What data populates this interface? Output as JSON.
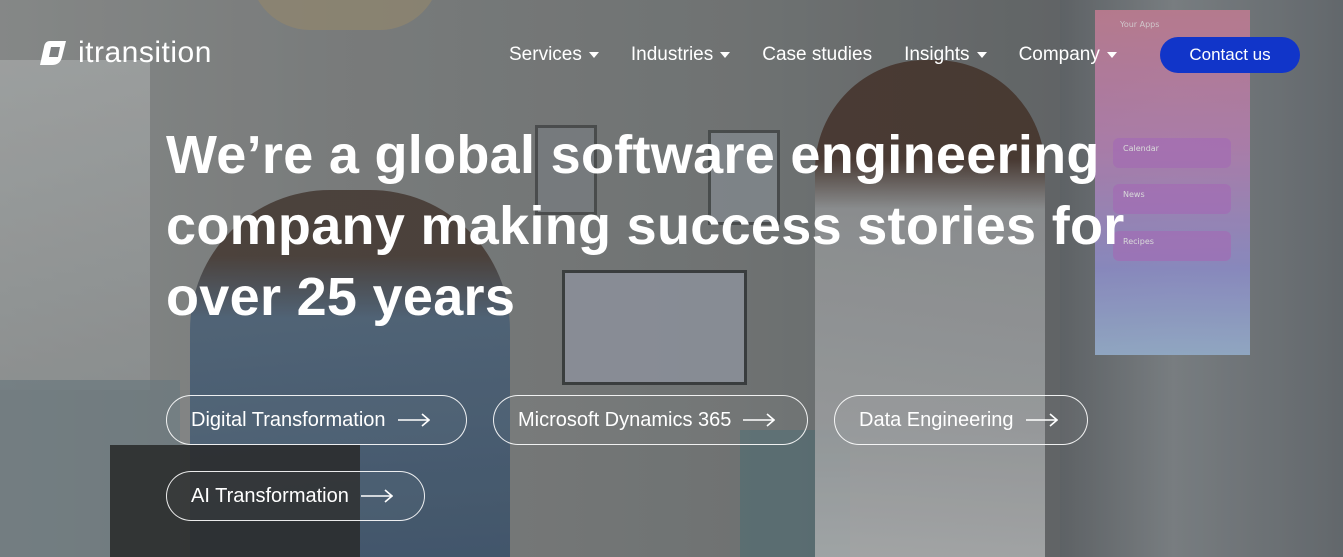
{
  "header": {
    "logo_text": "itransition",
    "nav": [
      {
        "label": "Services",
        "has_dropdown": true
      },
      {
        "label": "Industries",
        "has_dropdown": true
      },
      {
        "label": "Case studies",
        "has_dropdown": false
      },
      {
        "label": "Insights",
        "has_dropdown": true
      },
      {
        "label": "Company",
        "has_dropdown": true
      }
    ],
    "contact_label": "Contact us"
  },
  "hero": {
    "headline_line1": "We’re a global software engineering",
    "headline_line2": "company making success stories for",
    "headline_line3": "over 25 years",
    "pills": [
      {
        "label": "Digital Transformation"
      },
      {
        "label": "Microsoft Dynamics 365"
      },
      {
        "label": "Data Engineering"
      },
      {
        "label": "AI Transformation"
      }
    ]
  },
  "background": {
    "fridge_screen": {
      "title": "Your Apps",
      "tiles": [
        "Calendar",
        "News",
        "Recipes"
      ]
    }
  },
  "colors": {
    "accent": "#1135c9",
    "text": "#ffffff"
  },
  "icons": {
    "logo": "itransition-logo-icon",
    "dropdown": "chevron-down-icon",
    "pill_arrow": "arrow-right-icon"
  }
}
